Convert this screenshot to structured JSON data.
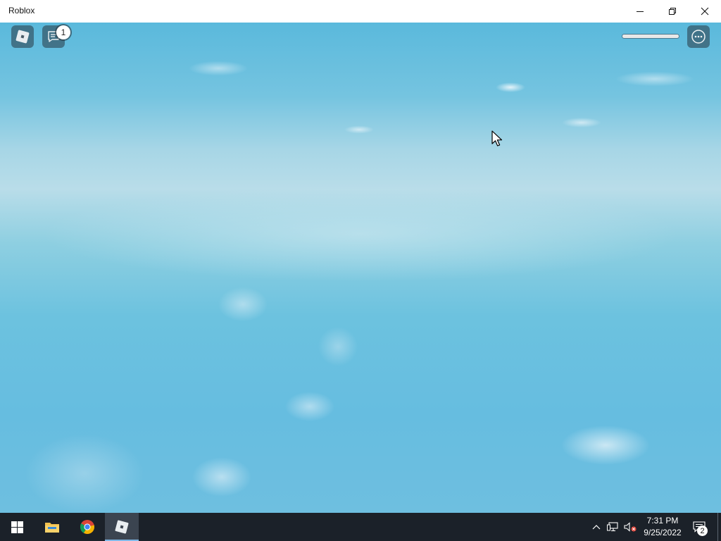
{
  "window": {
    "title": "Roblox"
  },
  "hud": {
    "chat_badge_count": "1",
    "health_fraction": 1.0
  },
  "taskbar": {
    "time": "7:31 PM",
    "date": "9/25/2022",
    "notification_count": "2",
    "pinned_apps": [
      "start-menu",
      "file-explorer",
      "chrome",
      "roblox"
    ]
  },
  "colors": {
    "sky": "#6ec2e0",
    "taskbar": "#1b2129",
    "active_underline": "#7fb8e8"
  }
}
